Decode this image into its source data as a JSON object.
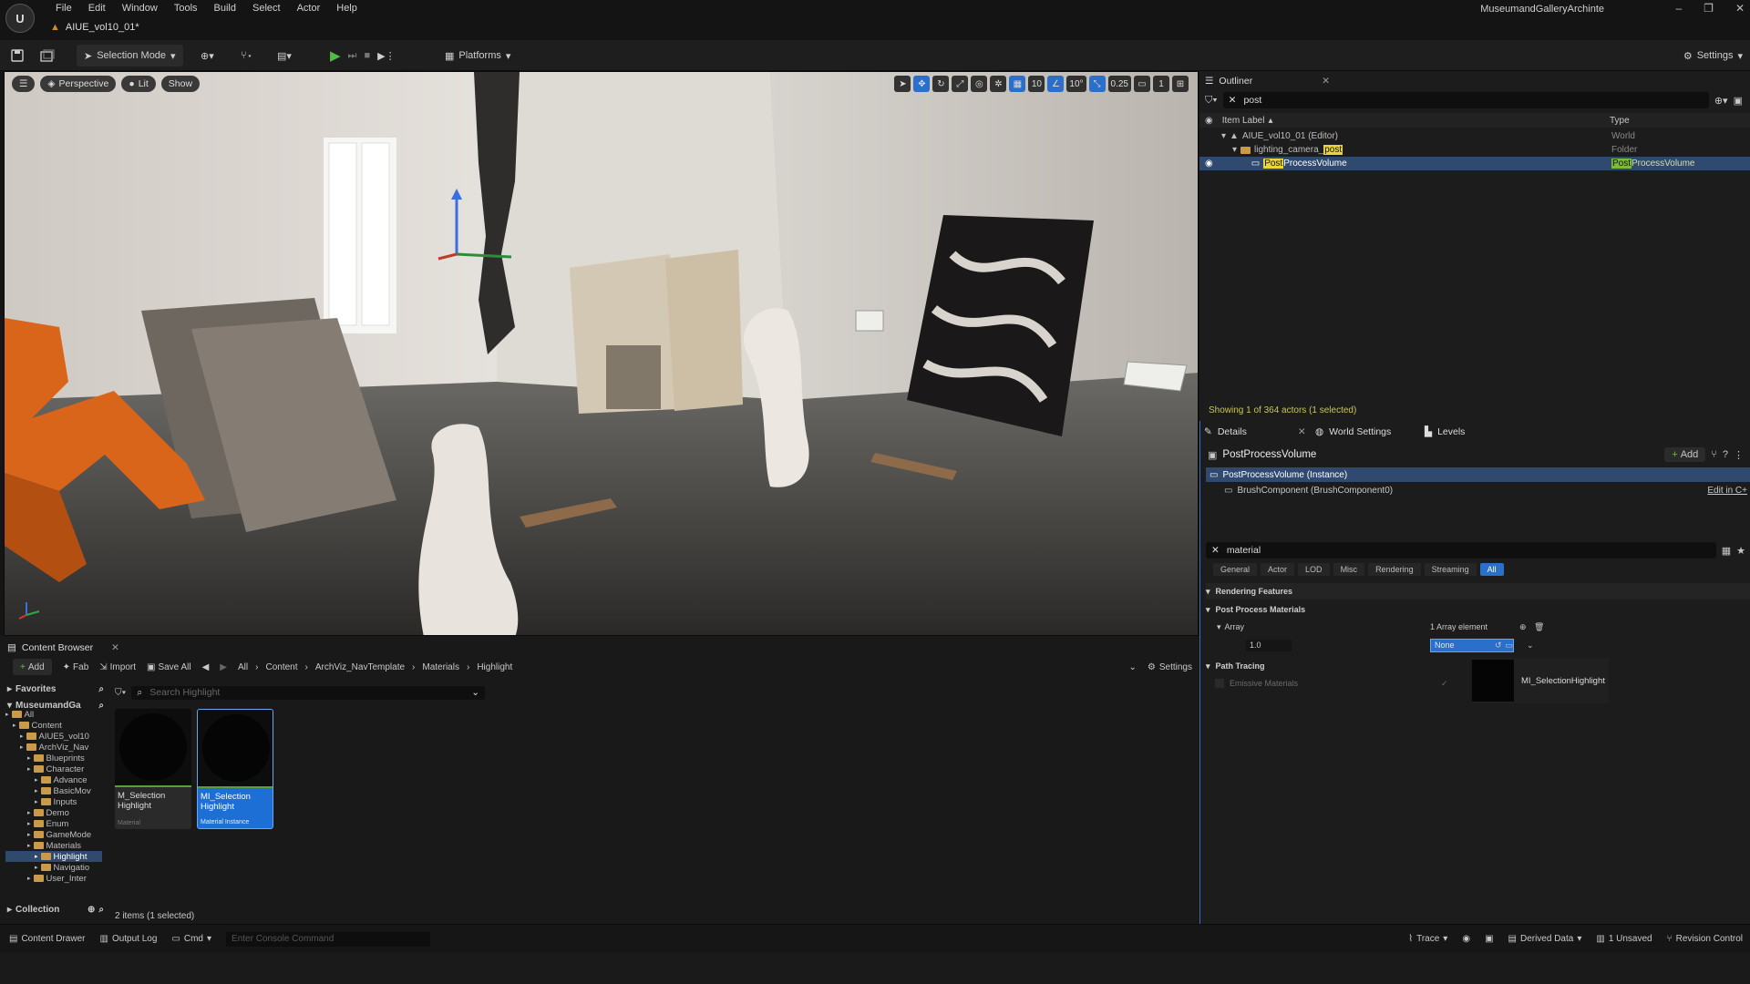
{
  "app": {
    "menu": [
      "File",
      "Edit",
      "Window",
      "Tools",
      "Build",
      "Select",
      "Actor",
      "Help"
    ],
    "tab": "AIUE_vol10_01*",
    "project_name": "MuseumandGalleryArchinte",
    "window_controls": [
      "–",
      "❐",
      "✕"
    ]
  },
  "toolbar": {
    "selection_mode": "Selection Mode",
    "platforms": "Platforms",
    "settings": "Settings"
  },
  "viewport": {
    "perspective": "Perspective",
    "lit": "Lit",
    "show": "Show",
    "grid_snap": "10",
    "rot_snap": "10°",
    "scale_snap": "0.25",
    "camera_speed": "1"
  },
  "outliner": {
    "tab": "Outliner",
    "search": "post",
    "col_label": "Item Label",
    "col_type": "Type",
    "rows": [
      {
        "pre": "AIUE_vol10_01 (Editor)",
        "hl": "",
        "post": "",
        "type": "World",
        "type_hl": "",
        "type_post": ""
      },
      {
        "pre": "lighting_camera_",
        "hl": "post",
        "post": "",
        "type": "Folder",
        "type_hl": "",
        "type_post": ""
      },
      {
        "pre": "",
        "hl": "Post",
        "post": "ProcessVolume",
        "type": "",
        "type_hl": "Post",
        "type_post": "ProcessVolume"
      }
    ],
    "status": "Showing 1 of 364 actors (1 selected)"
  },
  "details": {
    "tabs": [
      "Details",
      "World Settings",
      "Levels"
    ],
    "actor_name": "PostProcessVolume",
    "add_label": "Add",
    "instance_row": "PostProcessVolume (Instance)",
    "component_row": "BrushComponent (BrushComponent0)",
    "edit_link": "Edit in C+",
    "search": "material",
    "filters": [
      "General",
      "Actor",
      "LOD",
      "Misc",
      "Rendering",
      "Streaming",
      "All"
    ],
    "section_rendering": "Rendering Features",
    "section_ppm": "Post Process Materials",
    "array_label": "Array",
    "array_count": "1 Array element",
    "weight": "1.0",
    "asset_none": "None",
    "section_path_tracing": "Path Tracing",
    "emissive": "Emissive Materials",
    "tooltip": "MI_SelectionHighlight"
  },
  "content_browser": {
    "tab": "Content Browser",
    "add": "Add",
    "fab": "Fab",
    "import": "Import",
    "save_all": "Save All",
    "breadcrumb": [
      "All",
      "Content",
      "ArchViz_NavTemplate",
      "Materials",
      "Highlight"
    ],
    "settings": "Settings",
    "favorites": "Favorites",
    "project_root": "MuseumandGa",
    "search_placeholder": "Search Highlight",
    "tree": [
      {
        "label": "All",
        "depth": 0
      },
      {
        "label": "Content",
        "depth": 1
      },
      {
        "label": "AIUE5_vol10",
        "depth": 2
      },
      {
        "label": "ArchViz_Nav",
        "depth": 2
      },
      {
        "label": "Blueprints",
        "depth": 3
      },
      {
        "label": "Character",
        "depth": 3
      },
      {
        "label": "Advance",
        "depth": 4
      },
      {
        "label": "BasicMov",
        "depth": 4
      },
      {
        "label": "Inputs",
        "depth": 4
      },
      {
        "label": "Demo",
        "depth": 3
      },
      {
        "label": "Enum",
        "depth": 3
      },
      {
        "label": "GameMode",
        "depth": 3
      },
      {
        "label": "Materials",
        "depth": 3
      },
      {
        "label": "Highlight",
        "depth": 4
      },
      {
        "label": "Navigatio",
        "depth": 4
      },
      {
        "label": "User_Inter",
        "depth": 3
      }
    ],
    "collections": "Collection",
    "assets": [
      {
        "name": "M_Selection Highlight",
        "type": "Material"
      },
      {
        "name": "MI_Selection Highlight",
        "type": "Material Instance"
      }
    ],
    "count": "2 items (1 selected)"
  },
  "statusbar": {
    "content_drawer": "Content Drawer",
    "output_log": "Output Log",
    "cmd": "Cmd",
    "console_placeholder": "Enter Console Command",
    "trace": "Trace",
    "derived_data": "Derived Data",
    "unsaved": "1 Unsaved",
    "revision_control": "Revision Control"
  }
}
